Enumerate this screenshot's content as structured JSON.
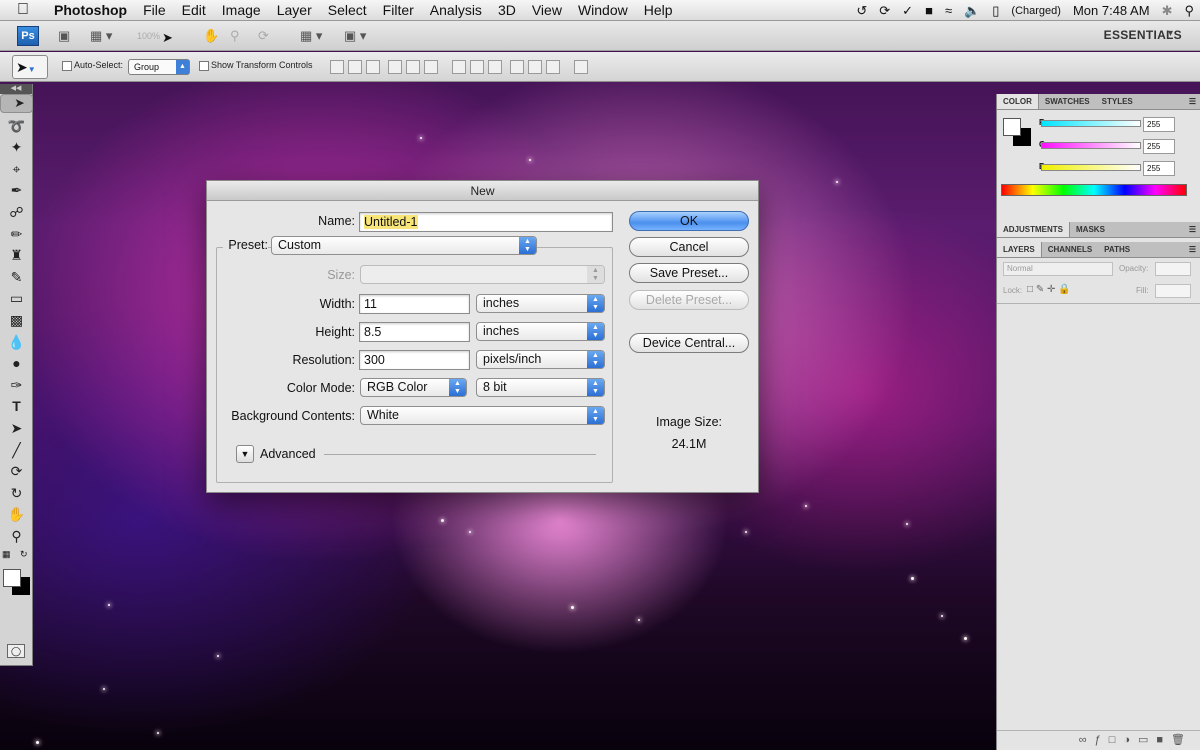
{
  "menubar": {
    "app_name": "Photoshop",
    "items": [
      "File",
      "Edit",
      "Image",
      "Layer",
      "Select",
      "Filter",
      "Analysis",
      "3D",
      "View",
      "Window",
      "Help"
    ],
    "battery": "(Charged)",
    "clock": "Mon 7:48 AM"
  },
  "appbar": {
    "badge": "Ps",
    "zoom": "100%",
    "workspace": "ESSENTIALS"
  },
  "options": {
    "auto_select_label": "Auto-Select:",
    "auto_select_value": "Group",
    "transform_label": "Show Transform Controls"
  },
  "panels": {
    "color_tabs": [
      "COLOR",
      "SWATCHES",
      "STYLES"
    ],
    "channels": [
      {
        "label": "R",
        "value": "255",
        "color": "#00e5ff"
      },
      {
        "label": "G",
        "value": "255",
        "color": "#ff10ff"
      },
      {
        "label": "B",
        "value": "255",
        "color": "#f0f000"
      }
    ],
    "adjust_tabs": [
      "ADJUSTMENTS",
      "MASKS"
    ],
    "layer_tabs": [
      "LAYERS",
      "CHANNELS",
      "PATHS"
    ],
    "blend_mode": "Normal",
    "opacity_label": "Opacity:",
    "lock_label": "Lock:",
    "fill_label": "Fill:"
  },
  "dialog": {
    "title": "New",
    "name_label": "Name:",
    "name_value": "Untitled-1",
    "preset_label": "Preset:",
    "preset_value": "Custom",
    "size_label": "Size:",
    "width_label": "Width:",
    "width_value": "11",
    "width_unit": "inches",
    "height_label": "Height:",
    "height_value": "8.5",
    "height_unit": "inches",
    "resolution_label": "Resolution:",
    "resolution_value": "300",
    "resolution_unit": "pixels/inch",
    "color_mode_label": "Color Mode:",
    "color_mode_value": "RGB Color",
    "bit_depth": "8 bit",
    "bg_label": "Background Contents:",
    "bg_value": "White",
    "advanced_label": "Advanced",
    "ok": "OK",
    "cancel": "Cancel",
    "save_preset": "Save Preset...",
    "delete_preset": "Delete Preset...",
    "device_central": "Device Central...",
    "image_size_label": "Image Size:",
    "image_size_value": "24.1M"
  }
}
